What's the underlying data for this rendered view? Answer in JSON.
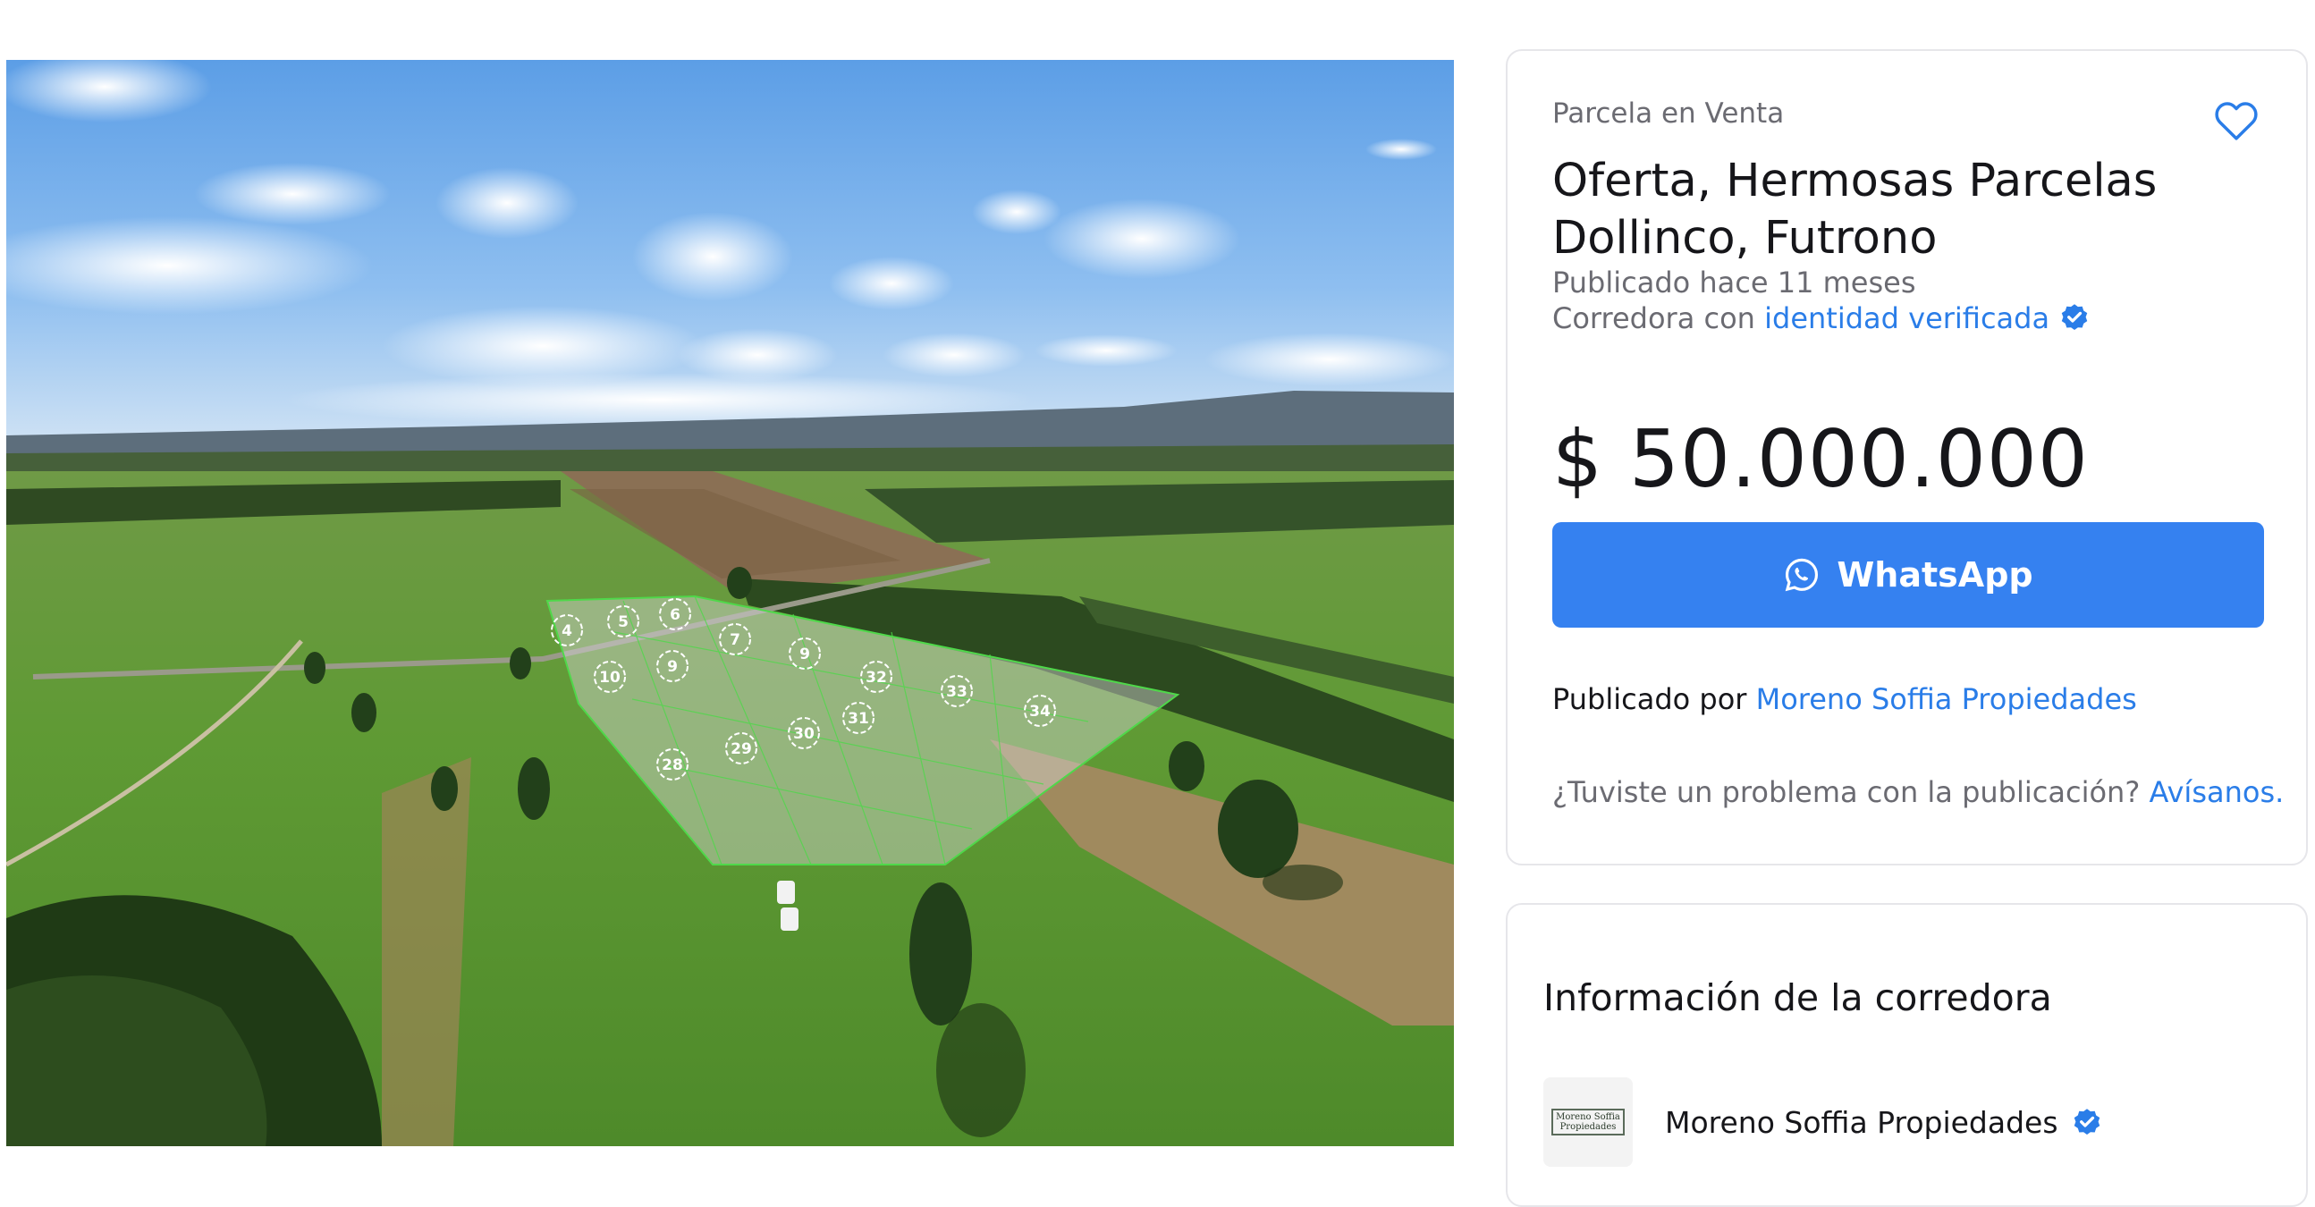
{
  "gallery": {
    "plot_labels": [
      "4",
      "5",
      "6",
      "7",
      "9",
      "10",
      "9",
      "32",
      "33",
      "34",
      "28",
      "29",
      "30",
      "31"
    ]
  },
  "listing": {
    "category": "Parcela en Venta",
    "title": "Oferta, Hermosas Parcelas Dollinco, Futrono",
    "published": "Publicado hace 11 meses",
    "broker_prefix": "Corredora con ",
    "broker_link": "identidad verificada",
    "price_symbol": "$",
    "price_value": "50.000.000",
    "whatsapp_label": "WhatsApp",
    "published_by_prefix": "Publicado por ",
    "published_by_link": "Moreno Soffia Propiedades",
    "report_prefix": "¿Tuviste un problema con la publicación? ",
    "report_link": "Avísanos."
  },
  "broker": {
    "heading": "Información de la corredora",
    "logo_line1": "Moreno Soffia",
    "logo_line2": "Propiedades",
    "name": "Moreno Soffia Propiedades"
  },
  "colors": {
    "accent": "#3581f0",
    "link": "#2a7de8",
    "muted": "#6b6b72"
  },
  "icons": {
    "favorite": "heart-icon",
    "verified": "verified-badge-icon",
    "whatsapp": "whatsapp-icon"
  }
}
